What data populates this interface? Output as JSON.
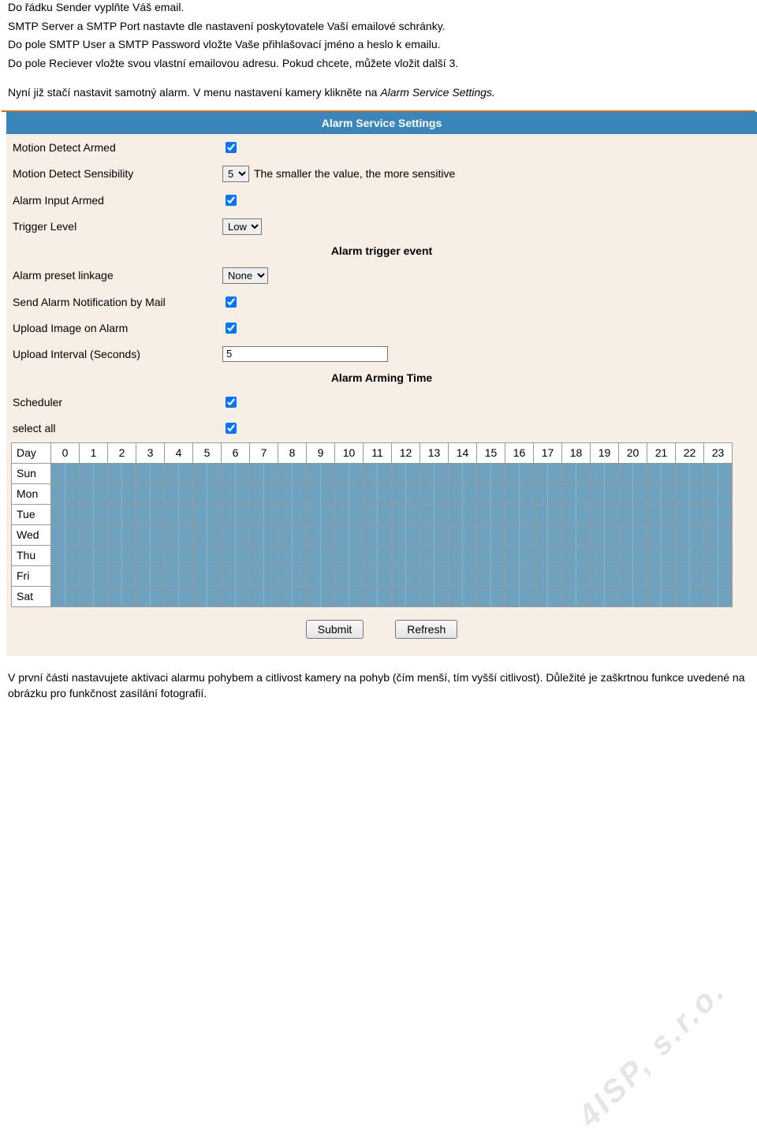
{
  "intro": {
    "line1": "Do řádku Sender vyplňte Váš email.",
    "line2": "SMTP Server a SMTP Port nastavte dle nastavení poskytovatele Vaší emailové schránky.",
    "line3": "Do pole SMTP User a SMTP Password vložte Vaše přihlašovací jméno a heslo k emailu.",
    "line4": "Do pole Reciever vložte svou vlastní emailovou adresu. Pokud chcete, můžete vložit další 3.",
    "line5a": "Nyní již stačí nastavit samotný alarm. V menu nastavení kamery klikněte na ",
    "line5b": "Alarm Service Settings."
  },
  "form": {
    "title": "Alarm Service Settings",
    "rows": {
      "motion_detect_armed": "Motion Detect Armed",
      "motion_detect_sensibility": "Motion Detect Sensibility",
      "sensibility_value": "5",
      "sensibility_hint": "The smaller the value, the more sensitive",
      "alarm_input_armed": "Alarm Input Armed",
      "trigger_level": "Trigger Level",
      "trigger_level_value": "Low",
      "section_trigger_event": "Alarm trigger event",
      "alarm_preset_linkage": "Alarm preset linkage",
      "alarm_preset_linkage_value": "None",
      "send_alarm_mail": "Send Alarm Notification by Mail",
      "upload_image": "Upload Image on Alarm",
      "upload_interval": "Upload Interval (Seconds)",
      "upload_interval_value": "5",
      "section_arming_time": "Alarm Arming Time",
      "scheduler": "Scheduler",
      "select_all": "select all"
    },
    "schedule": {
      "day_label": "Day",
      "hours": [
        "0",
        "1",
        "2",
        "3",
        "4",
        "5",
        "6",
        "7",
        "8",
        "9",
        "10",
        "11",
        "12",
        "13",
        "14",
        "15",
        "16",
        "17",
        "18",
        "19",
        "20",
        "21",
        "22",
        "23"
      ],
      "days": [
        "Sun",
        "Mon",
        "Tue",
        "Wed",
        "Thu",
        "Fri",
        "Sat"
      ]
    },
    "buttons": {
      "submit": "Submit",
      "refresh": "Refresh"
    }
  },
  "footer": {
    "text": "V první části nastavujete aktivaci alarmu pohybem a citlivost kamery na pohyb (čím menší, tím vyšší citlivost). Důležité je zaškrtnou funkce uvedené na obrázku pro funkčnost zasílání fotografií."
  },
  "watermark": "4ISP, s.r.o."
}
